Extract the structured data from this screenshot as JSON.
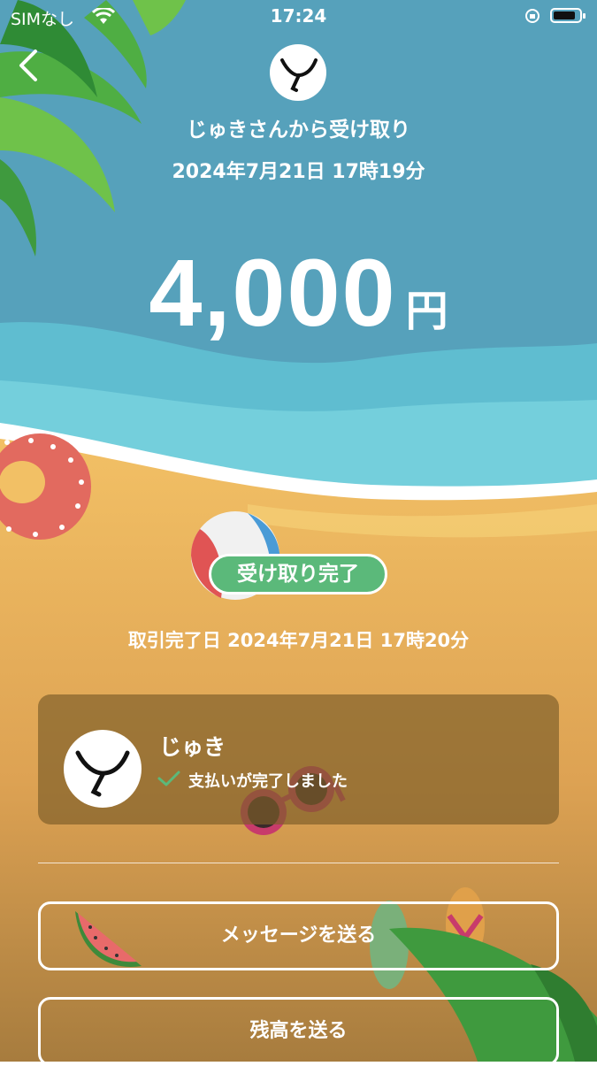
{
  "status_bar": {
    "carrier": "SIMなし",
    "time": "17:24"
  },
  "transaction": {
    "title": "じゅきさんから受け取り",
    "datetime": "2024年7月21日 17時19分",
    "amount": "4,000",
    "currency": "円",
    "status_label": "受け取り完了",
    "status_color": "#5bb97a",
    "completed_date": "取引完了日 2024年7月21日 17時20分"
  },
  "user_card": {
    "name": "じゅき",
    "payment_status": "支払いが完了しました"
  },
  "actions": {
    "send_message_label": "メッセージを送る",
    "send_balance_label": "残高を送る"
  },
  "icons": [
    "chevron-left-icon",
    "wifi-icon",
    "orientation-lock-icon",
    "battery-icon",
    "checkmark-icon",
    "user-avatar-icon"
  ]
}
